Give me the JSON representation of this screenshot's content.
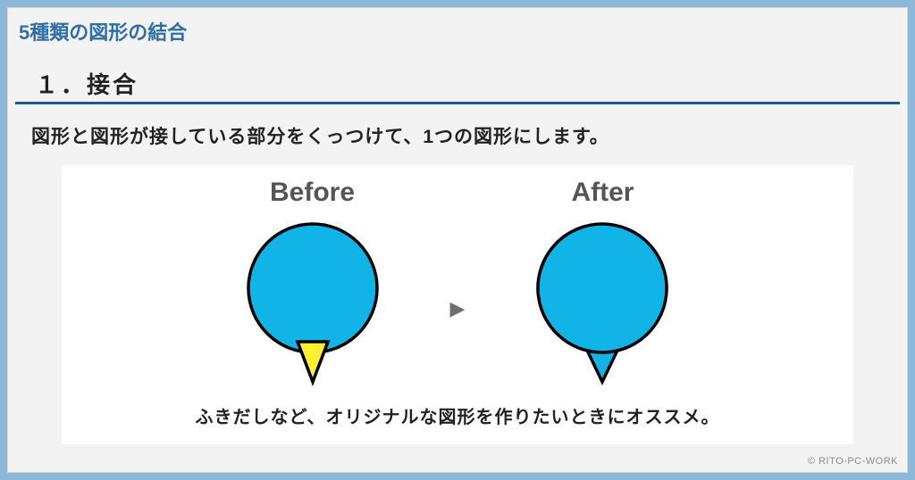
{
  "page_title": "5種類の図形の結合",
  "section": {
    "number": "１．",
    "title": "接合"
  },
  "description": "図形と図形が接している部分をくっつけて、1つの図形にします。",
  "example": {
    "before_label": "Before",
    "after_label": "After",
    "arrow": "▶",
    "caption": "ふきだしなど、オリジナルな図形を作りたいときにオススメ。"
  },
  "copyright": "© RITO-PC-WORK",
  "colors": {
    "frame": "#8db8d8",
    "shape_fill": "#10b4e6",
    "triangle_fill": "#fff22d",
    "stroke": "#000000"
  }
}
